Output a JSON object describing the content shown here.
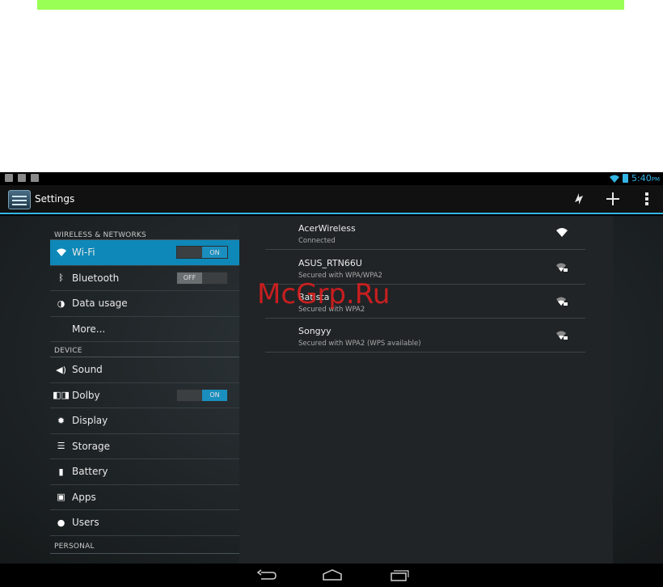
{
  "status_bar": {
    "time": "5:40",
    "ampm": "PM",
    "left_icons": [
      "shield-icon",
      "image-icon",
      "clipboard-icon"
    ],
    "right_icons": [
      "wifi-icon",
      "battery-icon"
    ]
  },
  "action_bar": {
    "title": "Settings",
    "actions": [
      "refresh-wifi-icon",
      "add-icon",
      "overflow-menu-icon"
    ]
  },
  "sidebar": {
    "wireless_header": "WIRELESS & NETWORKS",
    "device_header": "DEVICE",
    "personal_header": "PERSONAL",
    "items": [
      {
        "label": "Wi-Fi",
        "icon": "wifi-icon",
        "toggle": "ON",
        "active": true
      },
      {
        "label": "Bluetooth",
        "icon": "bluetooth-icon",
        "toggle": "OFF"
      },
      {
        "label": "Data usage",
        "icon": "data-usage-icon"
      },
      {
        "label": "More..."
      },
      {
        "label": "Sound",
        "icon": "sound-icon"
      },
      {
        "label": "Dolby",
        "icon": "dolby-icon",
        "toggle": "ON"
      },
      {
        "label": "Display",
        "icon": "display-icon"
      },
      {
        "label": "Storage",
        "icon": "storage-icon"
      },
      {
        "label": "Battery",
        "icon": "battery-icon"
      },
      {
        "label": "Apps",
        "icon": "apps-icon"
      },
      {
        "label": "Users",
        "icon": "users-icon"
      }
    ]
  },
  "networks": [
    {
      "name": "AcerWireless",
      "status": "Connected",
      "secured": false
    },
    {
      "name": "ASUS_RTN66U",
      "status": "Secured with WPA/WPA2",
      "secured": true
    },
    {
      "name": "Batista",
      "status": "Secured with WPA2",
      "secured": true
    },
    {
      "name": "Songyy",
      "status": "Secured with WPA2 (WPS available)",
      "secured": true
    }
  ],
  "watermark": "McGrp.Ru",
  "colors": {
    "accent": "#33b5e5",
    "active_item": "#0e88b8",
    "top_bar": "#99ff55",
    "watermark": "#e61e1e"
  },
  "nav_bar": [
    "back-icon",
    "home-icon",
    "recent-apps-icon"
  ]
}
